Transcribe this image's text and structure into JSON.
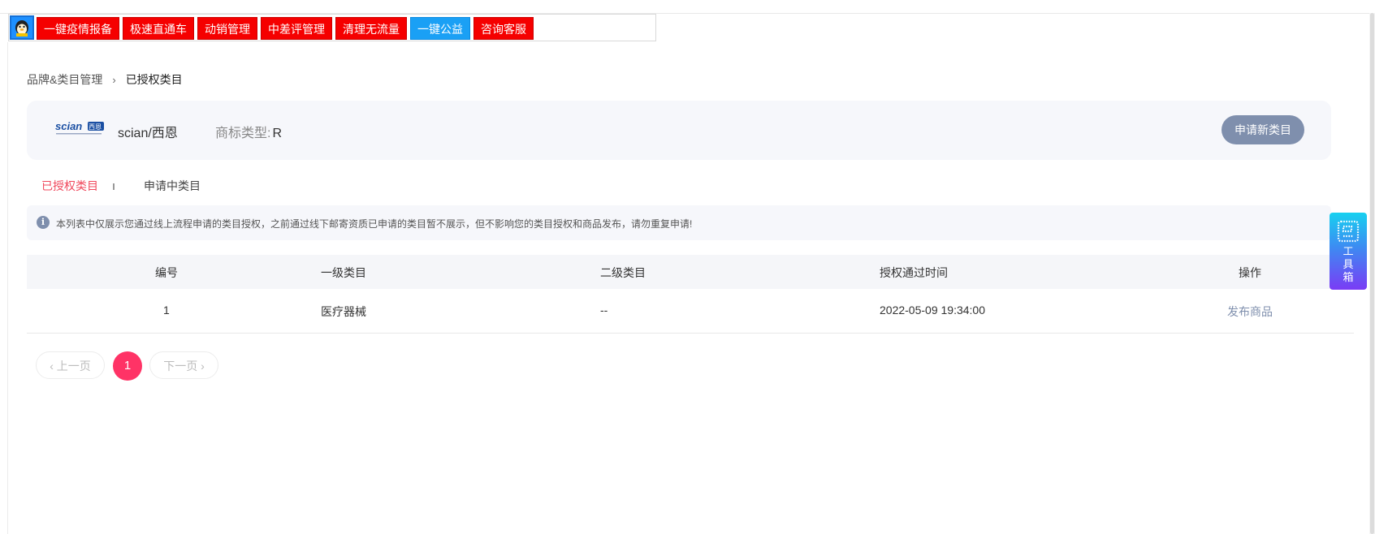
{
  "toolbar": {
    "buttons": [
      {
        "label": "一键疫情报备",
        "style": "red"
      },
      {
        "label": "极速直通车",
        "style": "red"
      },
      {
        "label": "动销管理",
        "style": "red"
      },
      {
        "label": "中差评管理",
        "style": "red"
      },
      {
        "label": "清理无流量",
        "style": "red"
      },
      {
        "label": "一键公益",
        "style": "blue"
      },
      {
        "label": "咨询客服",
        "style": "red"
      }
    ]
  },
  "breadcrumb": {
    "parent": "品牌&类目管理",
    "separator": "›",
    "current": "已授权类目"
  },
  "brand": {
    "logo_text": "scian西恩",
    "name": "scian/西恩",
    "type_label": "商标类型:",
    "type_value": "R",
    "apply_button": "申请新类目"
  },
  "tabs": [
    {
      "label": "已授权类目",
      "active": true
    },
    {
      "label": "申请中类目",
      "active": false
    }
  ],
  "notice": {
    "icon": "info-icon",
    "text": "本列表中仅展示您通过线上流程申请的类目授权，之前通过线下邮寄资质已申请的类目暂不展示，但不影响您的类目授权和商品发布，请勿重复申请!"
  },
  "table": {
    "headers": [
      "编号",
      "一级类目",
      "二级类目",
      "授权通过时间",
      "操作"
    ],
    "rows": [
      {
        "id": "1",
        "level1": "医疗器械",
        "level2": "--",
        "time": "2022-05-09 19:34:00",
        "action": "发布商品"
      }
    ]
  },
  "pagination": {
    "prev": "上一页",
    "current": "1",
    "next": "下一页"
  },
  "toolbox": {
    "label": "工具箱"
  },
  "colors": {
    "accent_pink": "#ff3366",
    "tab_active": "#f0485c",
    "muted_blue": "#7f8fad",
    "toolbar_red": "#f50000",
    "toolbar_blue": "#1aa0f5"
  }
}
